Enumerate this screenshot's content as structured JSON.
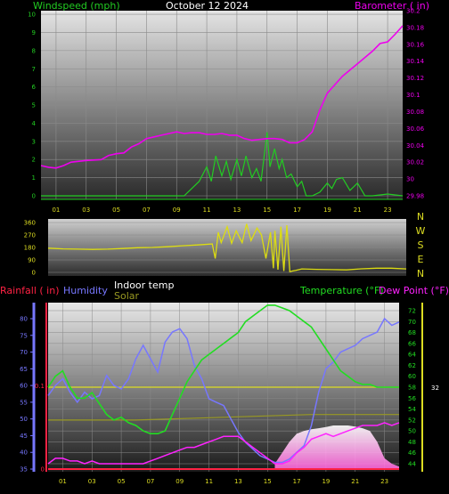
{
  "header": {
    "date": "October 12 2024",
    "windspeed_label": "Windspeed (mph)",
    "barometer_label": "Barometer ( in)",
    "rainfall_label": "Rainfall ( in)",
    "humidity_label": "Humidity",
    "indoor_label": "Indoor temp",
    "solar_label": "Solar",
    "temperature_label": "Temperature (°F)",
    "dewpoint_label": "Dew Point (°F)"
  },
  "colors": {
    "wind": "#22cc22",
    "barometer": "#ee00ee",
    "direction": "#dddd11",
    "humidity": "#7777ff",
    "temperature": "#22dd22",
    "dewpoint": "#ff22ff",
    "rain": "#ff2244",
    "indoor": "#999922",
    "solar": "#cccccc",
    "yellow_axis": "#dddd22"
  },
  "chart_data": [
    {
      "type": "line",
      "x_ticks": [
        "01",
        "03",
        "05",
        "07",
        "09",
        "11",
        "13",
        "15",
        "17",
        "19",
        "21",
        "23"
      ],
      "y_left_ticks": [
        "0",
        "1",
        "2",
        "3",
        "4",
        "5",
        "6",
        "7",
        "8",
        "9",
        "10"
      ],
      "y_right_ticks": [
        "29.98",
        "30",
        "30.02",
        "30.04",
        "30.06",
        "30.08",
        "30.1",
        "30.12",
        "30.14",
        "30.16",
        "30.18",
        "30.2"
      ],
      "xlim": [
        0,
        24
      ],
      "ylim_left": [
        0,
        10.2
      ],
      "ylim_right": [
        29.98,
        30.2
      ],
      "series": [
        {
          "name": "Windspeed (mph)",
          "axis": "left",
          "x": [
            0,
            9.5,
            10,
            10.5,
            11,
            11.3,
            11.6,
            12,
            12.3,
            12.6,
            13,
            13.3,
            13.6,
            14,
            14.3,
            14.6,
            15,
            15.2,
            15.5,
            15.8,
            16,
            16.3,
            16.6,
            17,
            17.3,
            17.6,
            18,
            18.5,
            19,
            19.3,
            19.6,
            20,
            20.5,
            21,
            21.5,
            22,
            23,
            24
          ],
          "y": [
            0,
            0,
            0.4,
            0.8,
            1.6,
            0.8,
            2.2,
            1.1,
            1.9,
            0.9,
            2.0,
            1.1,
            2.2,
            1.0,
            1.5,
            0.8,
            3.5,
            1.6,
            2.6,
            1.5,
            2.0,
            1.0,
            1.2,
            0.5,
            0.8,
            0,
            0,
            0.2,
            0.7,
            0.4,
            0.9,
            1.0,
            0.3,
            0.7,
            0,
            0,
            0.1,
            0
          ]
        },
        {
          "name": "Barometer ( in)",
          "axis": "right",
          "x": [
            0,
            0.5,
            1,
            1.5,
            2,
            3,
            4,
            4.5,
            5,
            5.5,
            6,
            6.5,
            7,
            7.5,
            8,
            8.5,
            9,
            9.5,
            10,
            10.5,
            11,
            11.5,
            12,
            12.5,
            13,
            13.5,
            14,
            14.5,
            15,
            15.5,
            16,
            16.5,
            17,
            17.5,
            18,
            18.5,
            19,
            20,
            21,
            22,
            22.5,
            23,
            23.5,
            24
          ],
          "y": [
            30.016,
            30.014,
            30.013,
            30.016,
            30.02,
            30.022,
            30.023,
            30.028,
            30.03,
            30.031,
            30.038,
            30.042,
            30.048,
            30.05,
            30.052,
            30.054,
            30.056,
            30.054,
            30.055,
            30.055,
            30.053,
            30.053,
            30.054,
            30.052,
            30.052,
            30.048,
            30.046,
            30.047,
            30.048,
            30.048,
            30.047,
            30.043,
            30.043,
            30.047,
            30.056,
            30.082,
            30.102,
            30.122,
            30.137,
            30.152,
            30.161,
            30.163,
            30.172,
            30.182
          ]
        }
      ]
    },
    {
      "type": "line",
      "y_ticks": [
        "360",
        "270",
        "180",
        "90",
        "0"
      ],
      "ylim": [
        0,
        360
      ],
      "compass_labels": [
        "N",
        "W",
        "S",
        "E",
        "N"
      ],
      "series": [
        {
          "name": "Wind direction",
          "x": [
            0,
            1,
            2,
            3,
            4,
            5,
            6,
            7,
            8,
            9,
            10,
            11,
            11.2,
            11.4,
            11.6,
            12,
            12.3,
            12.6,
            13,
            13.3,
            13.6,
            14,
            14.3,
            14.6,
            14.9,
            15.1,
            15.2,
            15.4,
            15.6,
            15.8,
            16,
            16.2,
            16.4,
            16.6,
            17,
            18,
            19,
            20,
            21,
            22,
            23,
            24
          ],
          "y": [
            175,
            170,
            168,
            166,
            168,
            172,
            178,
            180,
            185,
            192,
            198,
            205,
            100,
            290,
            215,
            330,
            210,
            300,
            215,
            350,
            230,
            320,
            270,
            100,
            290,
            30,
            300,
            20,
            330,
            10,
            340,
            5,
            10,
            15,
            25,
            22,
            20,
            18,
            26,
            30,
            30,
            25
          ]
        }
      ]
    },
    {
      "type": "line",
      "humidity_ticks": [
        "35",
        "40",
        "45",
        "50",
        "55",
        "60",
        "65",
        "70",
        "75",
        "80"
      ],
      "rain_ticks": [
        "0",
        "0.1"
      ],
      "temp_ticks": [
        "44",
        "46",
        "48",
        "50",
        "52",
        "54",
        "56",
        "58",
        "60",
        "62",
        "64",
        "66",
        "68",
        "70",
        "72"
      ],
      "temp_marker": "32",
      "series": [
        {
          "name": "Humidity",
          "axis": "humidity",
          "x": [
            0,
            0.5,
            1,
            1.5,
            2,
            2.5,
            3,
            3.5,
            4,
            4.5,
            5,
            5.5,
            6,
            6.5,
            7,
            7.5,
            8,
            8.5,
            9,
            9.5,
            10,
            10.5,
            11,
            11.5,
            12,
            12.5,
            13,
            13.5,
            14,
            14.5,
            15,
            15.5,
            16,
            16.5,
            17,
            17.5,
            18,
            18.5,
            19,
            19.5,
            20,
            20.5,
            21,
            21.5,
            22,
            22.5,
            23,
            23.5,
            24
          ],
          "y": [
            57,
            60,
            62,
            58,
            55,
            58,
            56,
            57,
            63,
            60,
            59,
            62,
            68,
            72,
            68,
            64,
            73,
            76,
            77,
            74,
            66,
            62,
            56,
            55,
            54,
            50,
            46,
            43,
            41,
            39,
            38,
            37,
            37,
            38,
            40,
            42,
            48,
            58,
            65,
            67,
            70,
            71,
            72,
            74,
            75,
            76,
            80,
            78,
            79
          ]
        },
        {
          "name": "Temperature (°F)",
          "axis": "temp",
          "x": [
            0,
            0.5,
            1,
            1.5,
            2,
            2.5,
            3,
            3.5,
            4,
            4.5,
            5,
            5.5,
            6,
            6.5,
            7,
            7.5,
            8,
            8.5,
            9,
            9.5,
            10,
            10.5,
            11,
            11.5,
            12,
            12.5,
            13,
            13.5,
            14,
            14.5,
            15,
            15.5,
            16,
            16.5,
            17,
            17.5,
            18,
            18.5,
            19,
            19.5,
            20,
            20.5,
            21,
            21.5,
            22,
            22.5,
            23,
            23.5,
            24
          ],
          "y": [
            58,
            60,
            61,
            58,
            56,
            56,
            57,
            55,
            53,
            52,
            52.5,
            51.5,
            51,
            50,
            49.5,
            49.5,
            50,
            53,
            56,
            59,
            61,
            63,
            64,
            65,
            66,
            67,
            68,
            70,
            71,
            72,
            73,
            73,
            72.5,
            72,
            71,
            70,
            69,
            67,
            65,
            63,
            61,
            60,
            59,
            58.5,
            58.5,
            58,
            58,
            58,
            58
          ]
        },
        {
          "name": "Dew Point (°F)",
          "axis": "temp",
          "x": [
            0,
            0.5,
            1,
            1.5,
            2,
            2.5,
            3,
            3.5,
            4,
            4.5,
            5,
            5.5,
            6,
            6.5,
            7,
            7.5,
            8,
            8.5,
            9,
            9.5,
            10,
            10.5,
            11,
            11.5,
            12,
            12.5,
            13,
            13.5,
            14,
            14.5,
            15,
            15.5,
            16,
            16.5,
            17,
            17.5,
            18,
            18.5,
            19,
            19.5,
            20,
            20.5,
            21,
            21.5,
            22,
            22.5,
            23,
            23.5,
            24
          ],
          "y": [
            44,
            45,
            45,
            44.5,
            44.5,
            44,
            44.5,
            44,
            44,
            44,
            44,
            44,
            44,
            44,
            44.5,
            45,
            45.5,
            46,
            46.5,
            47,
            47,
            47.5,
            48,
            48.5,
            49,
            49,
            49,
            48,
            47,
            46,
            45,
            44,
            44,
            44.5,
            46,
            47,
            48.5,
            49,
            49.5,
            49,
            49.5,
            50,
            50.5,
            51,
            51,
            51,
            51.5,
            51,
            51.5
          ]
        },
        {
          "name": "Indoor temp",
          "axis": "temp",
          "x": [
            0,
            6,
            12,
            18,
            24
          ],
          "y": [
            52,
            52,
            52.5,
            53,
            53
          ]
        },
        {
          "name": "Solar",
          "axis": "temp",
          "x": [
            15.5,
            16,
            16.5,
            17,
            17.5,
            18,
            18.5,
            19,
            19.5,
            20,
            20.5,
            21,
            21.5,
            22,
            22.5,
            23,
            23.5,
            24
          ],
          "y": [
            44,
            46,
            48,
            49.5,
            50,
            50.3,
            50.5,
            50.7,
            51,
            51,
            51,
            50.8,
            50.5,
            50,
            48,
            45,
            44,
            43.5
          ]
        },
        {
          "name": "Rainfall ( in)",
          "axis": "rain",
          "x": [
            0,
            24
          ],
          "y": [
            0,
            0
          ]
        }
      ]
    }
  ]
}
